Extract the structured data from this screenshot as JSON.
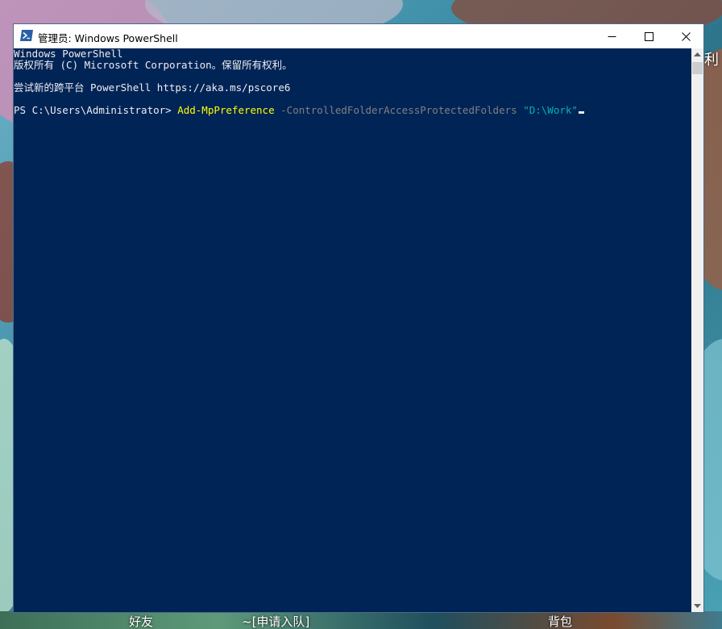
{
  "window": {
    "title": "管理员: Windows PowerShell",
    "icon": "powershell-icon"
  },
  "controls": {
    "minimize": "minimize-icon",
    "maximize": "maximize-icon",
    "close": "close-icon"
  },
  "console": {
    "lines": [
      "Windows PowerShell",
      "版权所有 (C) Microsoft Corporation。保留所有权利。",
      "",
      "尝试新的跨平台 PowerShell https://aka.ms/pscore6",
      ""
    ],
    "prompt": "PS C:\\Users\\Administrator> ",
    "command": "Add-MpPreference",
    "parameter": " -ControlledFolderAccessProtectedFolders ",
    "argument": "\"D:\\Work\""
  },
  "colors": {
    "console_bg": "#012456",
    "console_fg": "#eeedf0",
    "command": "#ffff00",
    "parameter": "#808080",
    "string": "#00b3b3"
  },
  "background": {
    "bottom_left_text": "好友",
    "bottom_center_text": "~[申请入队]",
    "bottom_right_text": "背包",
    "right_edge_text": "利"
  }
}
